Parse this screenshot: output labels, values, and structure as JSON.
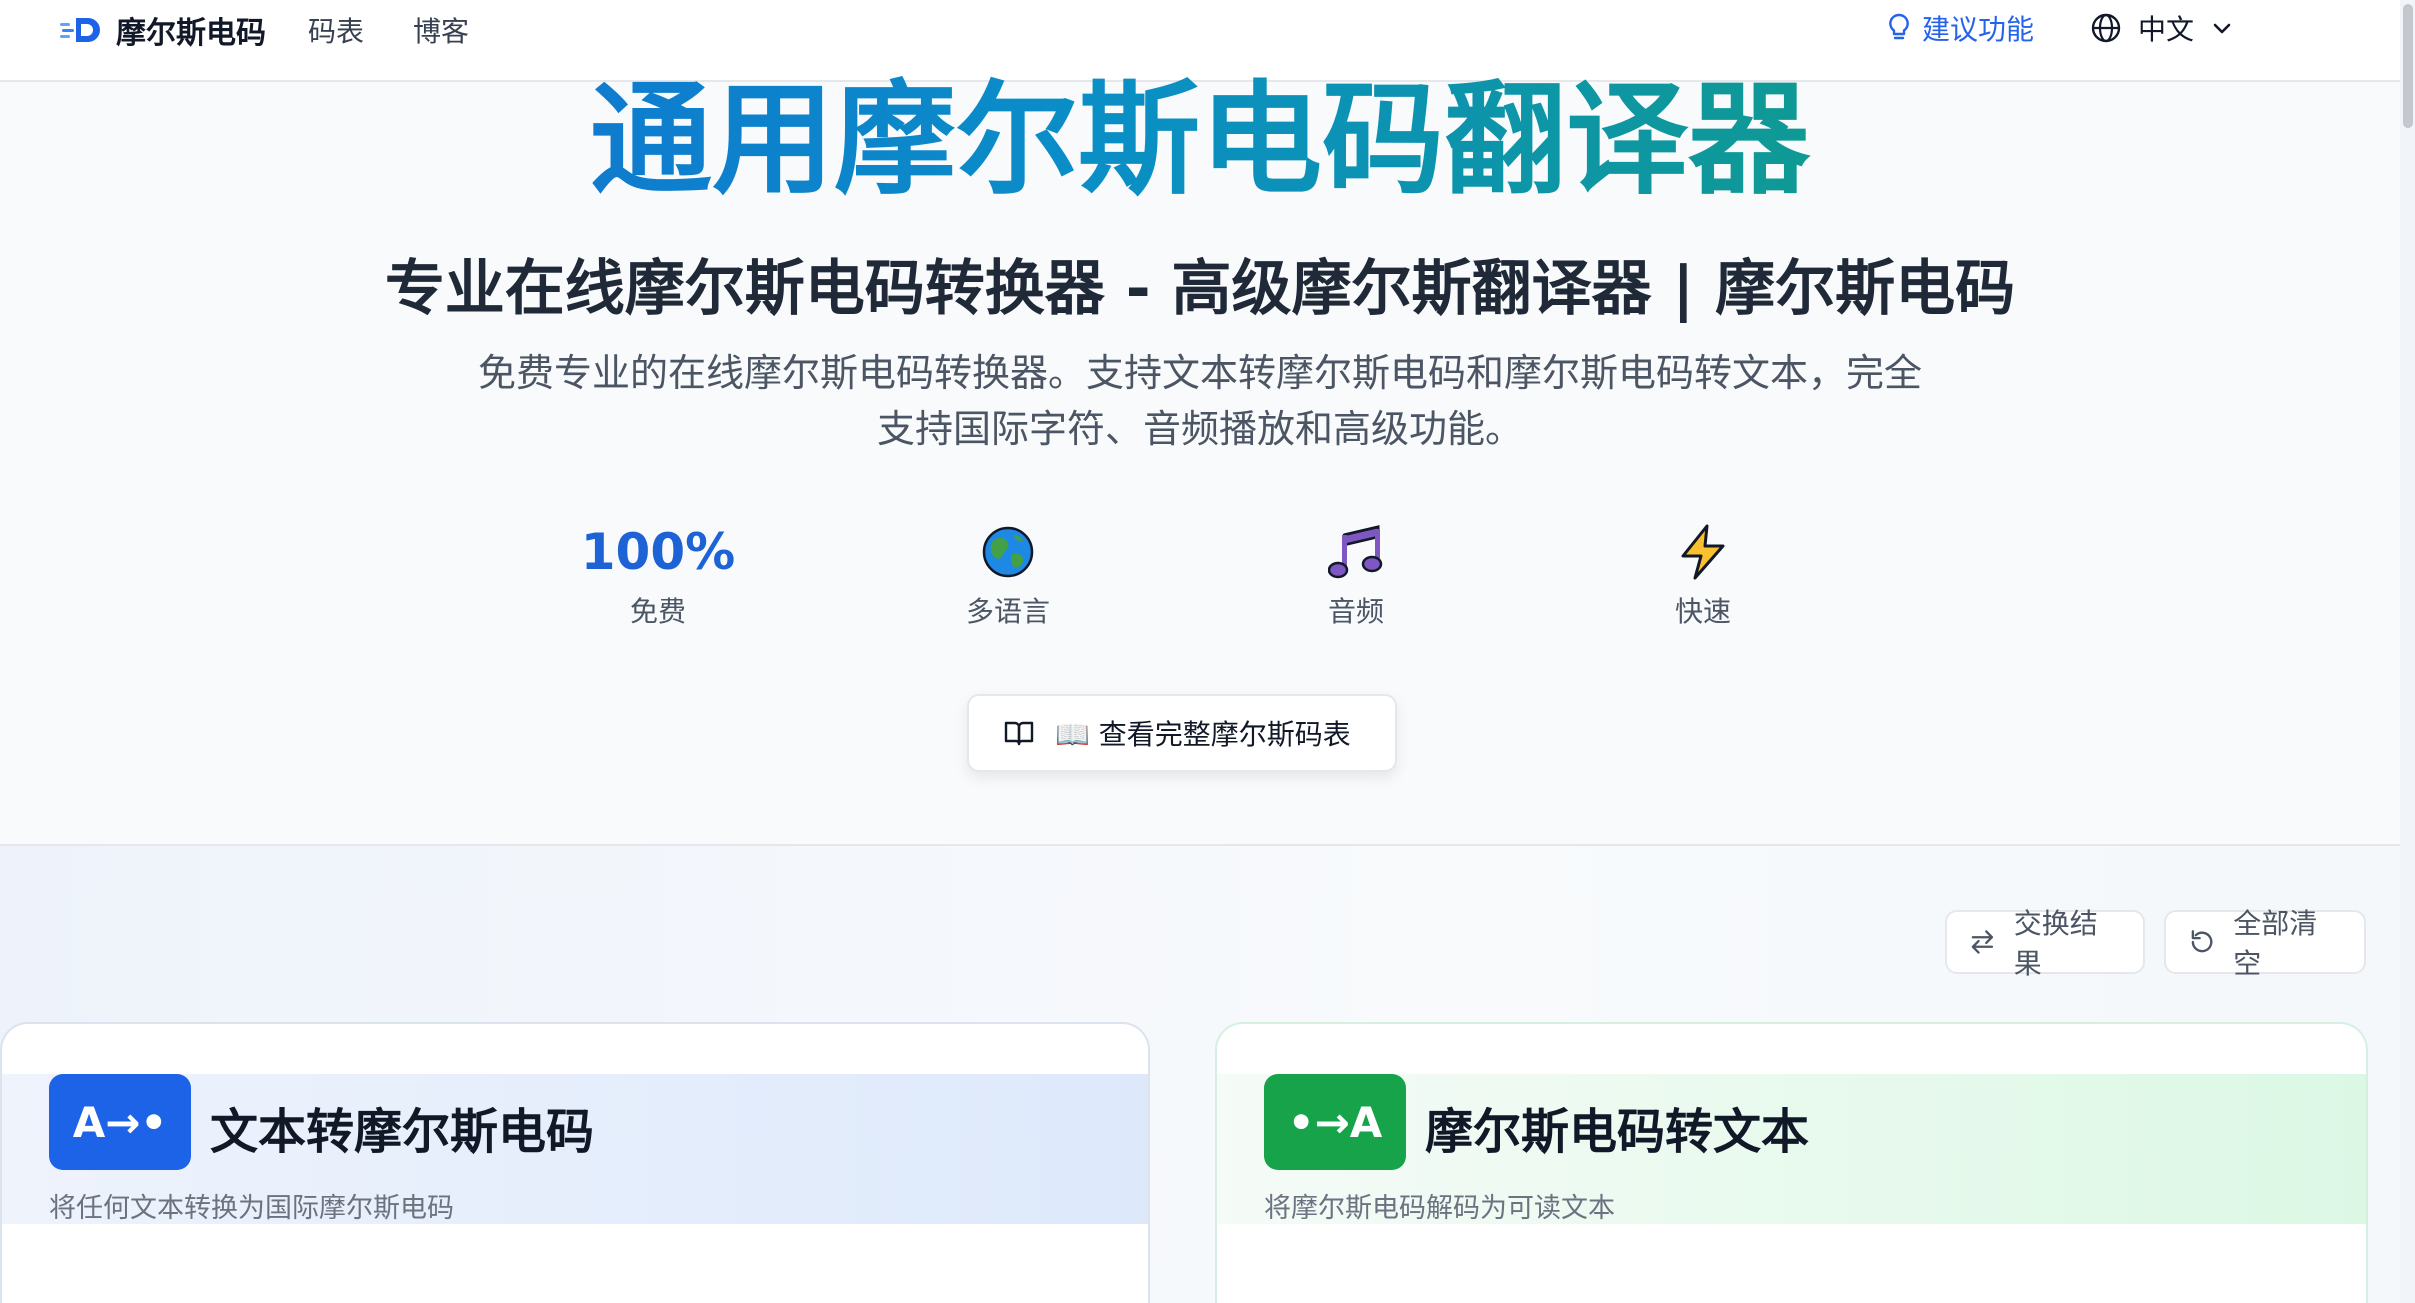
{
  "header": {
    "logo_text": "摩尔斯电码",
    "nav": [
      "码表",
      "博客"
    ],
    "suggest_label": "建议功能",
    "language": "中文"
  },
  "hero": {
    "title": "通用摩尔斯电码翻译器",
    "subtitle": "专业在线摩尔斯电码转换器 - 高级摩尔斯翻译器 | 摩尔斯电码",
    "desc_line1": "免费专业的在线摩尔斯电码转换器。支持文本转摩尔斯电码和摩尔斯电码转文本，完全",
    "desc_line2": "支持国际字符、音频播放和高级功能。",
    "stats": [
      {
        "value": "100%",
        "label": "免费"
      },
      {
        "icon": "globe-icon",
        "label": "多语言"
      },
      {
        "icon": "music-note-icon",
        "label": "音频"
      },
      {
        "icon": "lightning-icon",
        "label": "快速"
      }
    ],
    "chart_button": "📖 查看完整摩尔斯码表"
  },
  "actions": {
    "swap_label": "交换结果",
    "clear_label": "全部清空"
  },
  "panels": {
    "text_to_morse": {
      "badge": "A→•",
      "title": "文本转摩尔斯电码",
      "subtitle": "将任何文本转换为国际摩尔斯电码"
    },
    "morse_to_text": {
      "badge": "•→A",
      "title": "摩尔斯电码转文本",
      "subtitle": "将摩尔斯电码解码为可读文本"
    }
  },
  "colors": {
    "accent_blue": "#1d63e8",
    "accent_green": "#16a34a"
  }
}
